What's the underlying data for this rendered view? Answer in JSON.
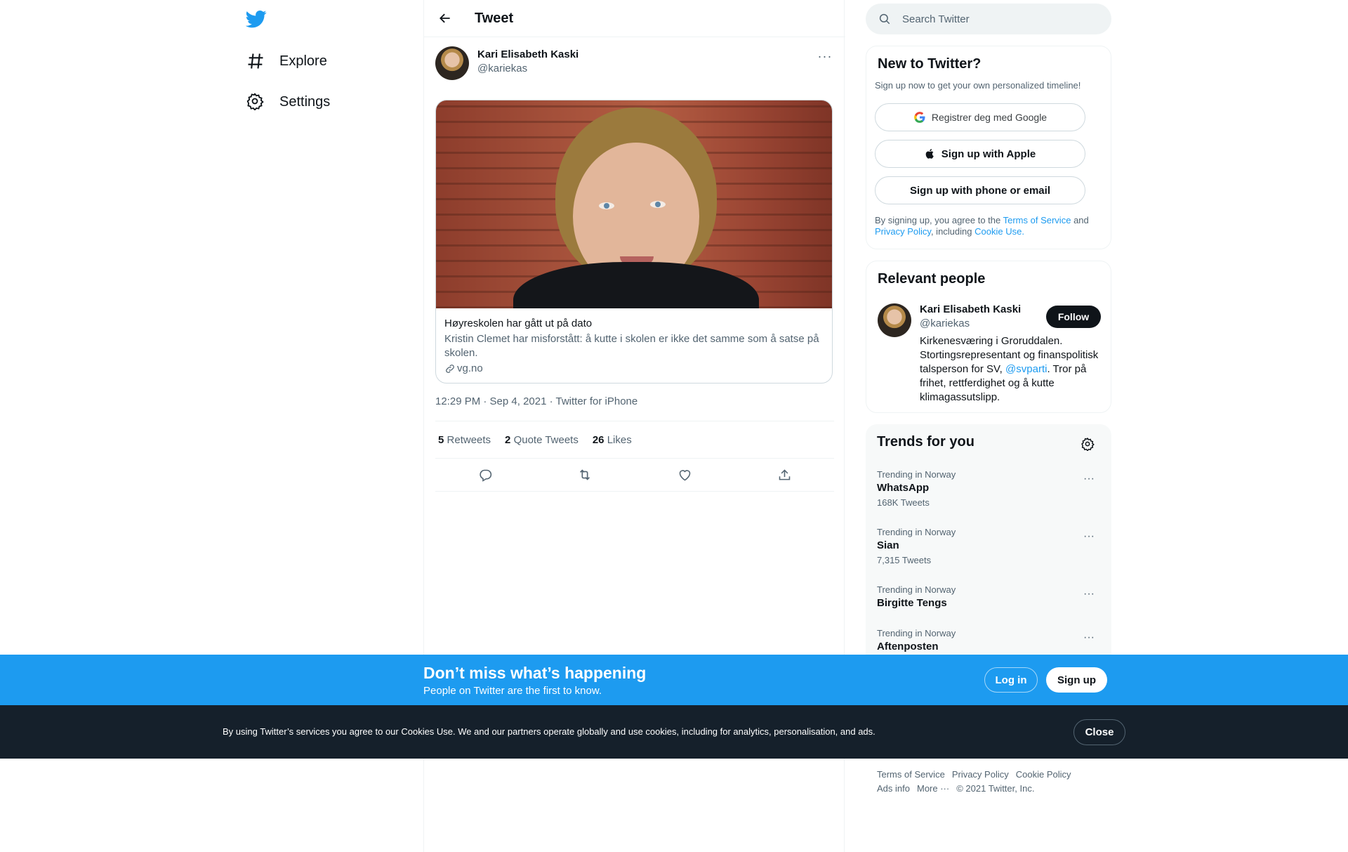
{
  "nav": {
    "logo_icon": "twitter-bird-icon",
    "items": [
      {
        "icon": "hashtag-icon",
        "label": "Explore"
      },
      {
        "icon": "gear-icon",
        "label": "Settings"
      }
    ]
  },
  "header": {
    "title": "Tweet"
  },
  "tweet": {
    "author_name": "Kari Elisabeth Kaski",
    "author_handle": "@kariekas",
    "card": {
      "title": "Høyreskolen har gått ut på dato",
      "description": "Kristin Clemet har misforstått: å kutte i skolen er ikke det samme som å satse på skolen.",
      "domain": "vg.no"
    },
    "meta": "12:29 PM · Sep 4, 2021 · Twitter for iPhone",
    "stats": {
      "retweets_count": "5",
      "retweets_label": "Retweets",
      "quotes_count": "2",
      "quotes_label": "Quote Tweets",
      "likes_count": "26",
      "likes_label": "Likes"
    }
  },
  "search": {
    "placeholder": "Search Twitter"
  },
  "signup_panel": {
    "title": "New to Twitter?",
    "subtitle": "Sign up now to get your own personalized timeline!",
    "google_label": "Registrer deg med Google",
    "apple_label": "Sign up with Apple",
    "phone_label": "Sign up with phone or email",
    "legal_prefix": "By signing up, you agree to the",
    "terms": "Terms of Service",
    "and": "and",
    "privacy": "Privacy Policy",
    "including": ", including",
    "cookie": "Cookie Use."
  },
  "relevant": {
    "title": "Relevant people",
    "name": "Kari Elisabeth Kaski",
    "handle": "@kariekas",
    "follow_label": "Follow",
    "bio_before": "Kirkenesværing i Groruddalen. Stortingsrepresentant og finanspolitisk talsperson for SV,",
    "bio_mention": "@svparti",
    "bio_after": ". Tror på frihet, rettferdighet og å kutte klimagassutslipp."
  },
  "trends": {
    "title": "Trends for you",
    "items": [
      {
        "context": "Trending in Norway",
        "name": "WhatsApp",
        "count": "168K Tweets"
      },
      {
        "context": "Trending in Norway",
        "name": "Sian",
        "count": "7,315 Tweets"
      },
      {
        "context": "Trending in Norway",
        "name": "Birgitte Tengs",
        "count": ""
      },
      {
        "context": "Trending in Norway",
        "name": "Aftenposten",
        "count": ""
      }
    ]
  },
  "footer": {
    "terms": "Terms of Service",
    "privacy": "Privacy Policy",
    "cookie": "Cookie Policy",
    "ads": "Ads info",
    "more": "More ···",
    "copyright": "© 2021 Twitter, Inc."
  },
  "promo": {
    "title": "Don’t miss what’s happening",
    "subtitle": "People on Twitter are the first to know.",
    "login_label": "Log in",
    "signup_label": "Sign up"
  },
  "cookie_bar": {
    "text": "By using Twitter’s services you agree to our Cookies Use. We and our partners operate globally and use cookies, including for analytics, personalisation, and ads.",
    "close_label": "Close"
  },
  "colors": {
    "accent": "#1d9bf0",
    "text": "#0f1419",
    "muted": "#536471",
    "dark_bar": "#15202b"
  }
}
